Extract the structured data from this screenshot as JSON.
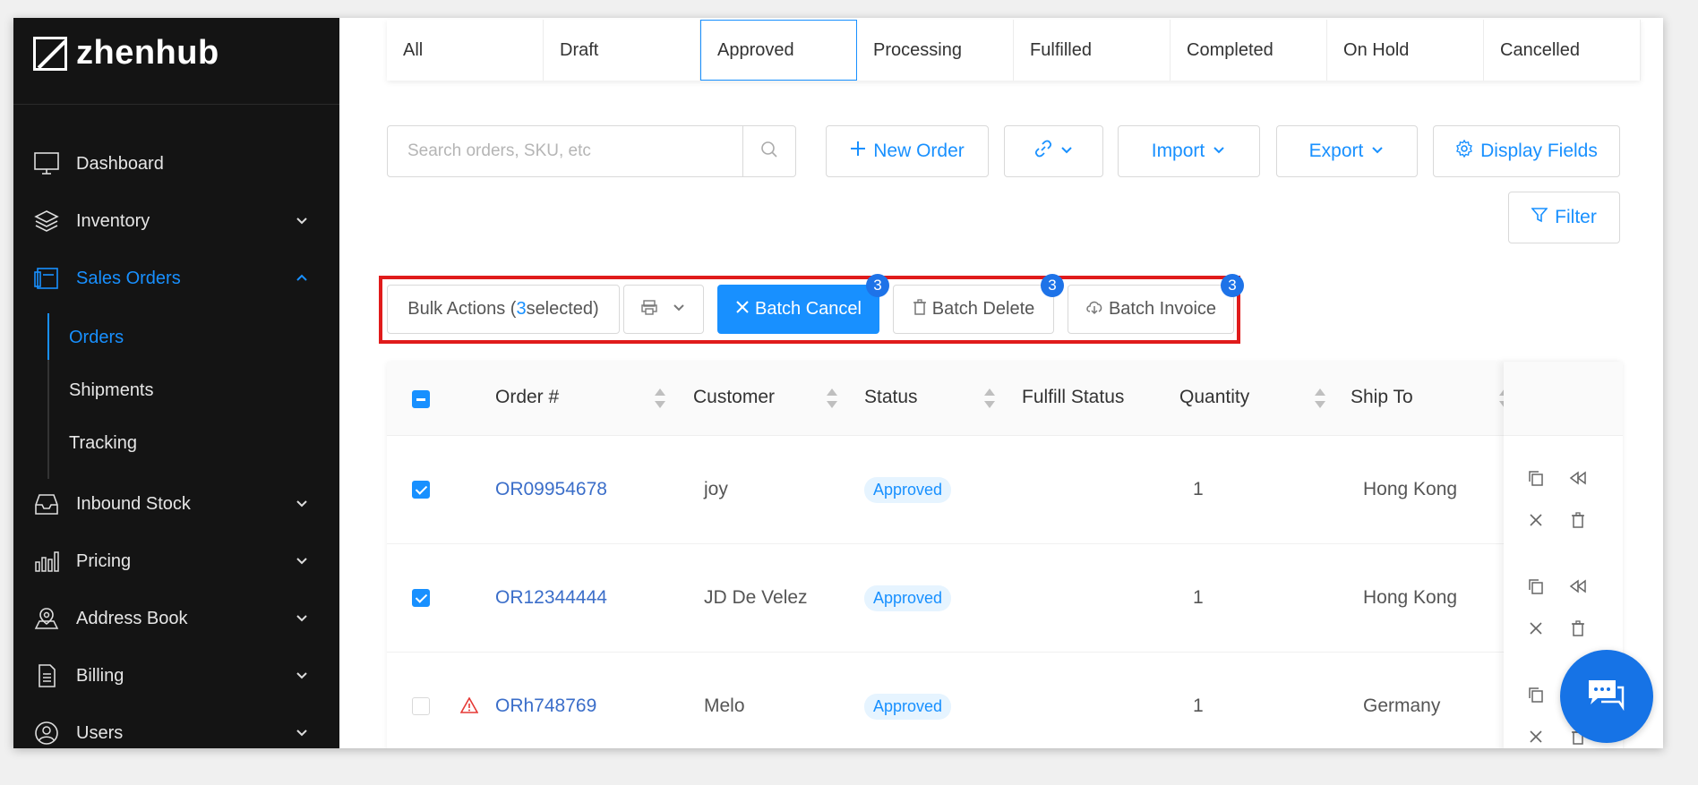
{
  "brand": {
    "name": "zhenhub"
  },
  "sidebar": {
    "items": [
      {
        "label": "Dashboard",
        "icon": "monitor-icon"
      },
      {
        "label": "Inventory",
        "icon": "layers-icon"
      },
      {
        "label": "Sales Orders",
        "icon": "sales-orders-icon"
      },
      {
        "label": "Inbound Stock",
        "icon": "inbox-icon"
      },
      {
        "label": "Pricing",
        "icon": "bar-chart-icon"
      },
      {
        "label": "Address Book",
        "icon": "map-pin-icon"
      },
      {
        "label": "Billing",
        "icon": "document-icon"
      },
      {
        "label": "Users",
        "icon": "user-icon"
      }
    ],
    "sub_items": [
      "Orders",
      "Shipments",
      "Tracking"
    ]
  },
  "tabs": [
    "All",
    "Draft",
    "Approved",
    "Processing",
    "Fulfilled",
    "Completed",
    "On Hold",
    "Cancelled"
  ],
  "toolbar": {
    "search_placeholder": "Search orders, SKU, etc",
    "new_order": "New Order",
    "import": "Import",
    "export": "Export",
    "display_fields": "Display Fields",
    "filter": "Filter"
  },
  "bulk": {
    "label_prefix": "Bulk Actions (",
    "count": "3",
    "label_suffix": " selected)",
    "batch_cancel": "Batch Cancel",
    "batch_delete": "Batch Delete",
    "batch_invoice": "Batch Invoice",
    "badge_cancel": "3",
    "badge_delete": "3",
    "badge_invoice": "3"
  },
  "table": {
    "headers": {
      "order": "Order #",
      "customer": "Customer",
      "status": "Status",
      "fulfill_status": "Fulfill Status",
      "quantity": "Quantity",
      "ship_to": "Ship To"
    },
    "rows": [
      {
        "order": "OR09954678",
        "customer": "joy",
        "status": "Approved",
        "quantity": "1",
        "ship_to": "Hong Kong",
        "checked": true,
        "warning": false
      },
      {
        "order": "OR12344444",
        "customer": "JD De Velez",
        "status": "Approved",
        "quantity": "1",
        "ship_to": "Hong Kong",
        "checked": true,
        "warning": false
      },
      {
        "order": "ORh748769",
        "customer": "Melo",
        "status": "Approved",
        "quantity": "1",
        "ship_to": "Germany",
        "checked": false,
        "warning": true
      }
    ]
  },
  "colors": {
    "accent": "#1890ff",
    "sidebar_bg": "#141414",
    "highlight_box": "#e01b1b"
  }
}
